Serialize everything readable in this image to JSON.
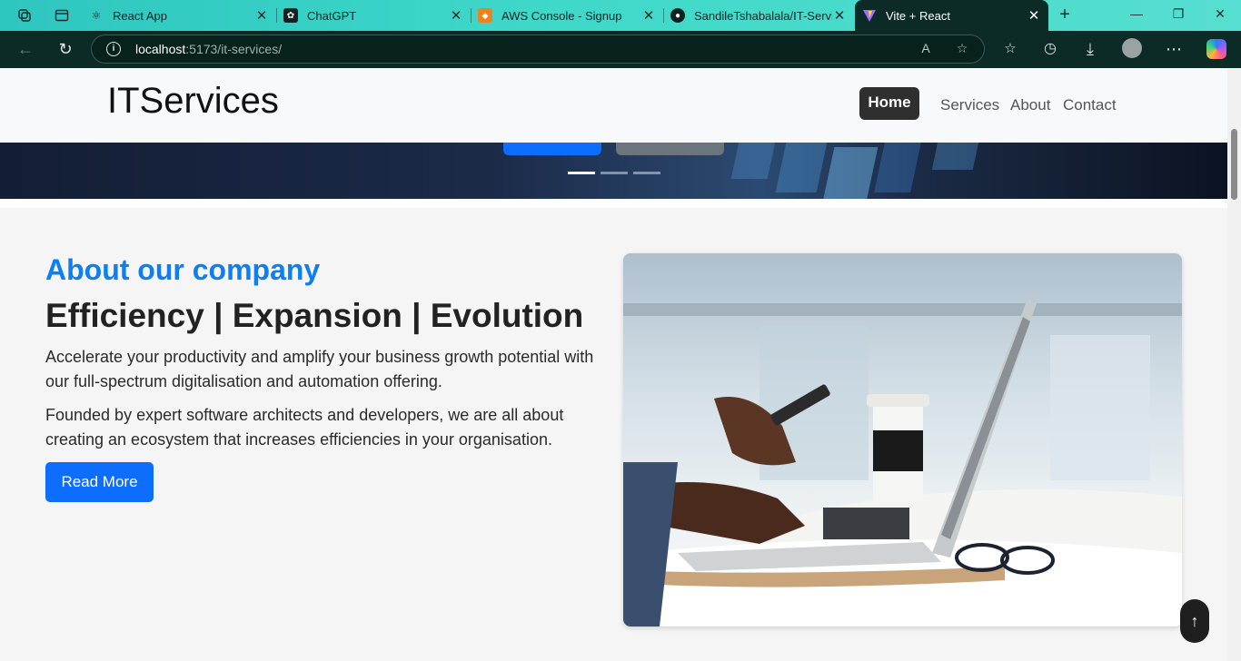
{
  "browser": {
    "tabs": [
      {
        "title": "React App",
        "icon": "react-icon"
      },
      {
        "title": "ChatGPT",
        "icon": "chatgpt-icon"
      },
      {
        "title": "AWS Console - Signup",
        "icon": "aws-icon"
      },
      {
        "title": "SandileTshabalala/IT-Service",
        "icon": "github-icon"
      },
      {
        "title": "Vite + React",
        "icon": "vite-icon",
        "active": true
      }
    ],
    "url_host": "localhost",
    "url_path": ":5173/it-services/",
    "accent": "#3fd8c9"
  },
  "navbar": {
    "brand": "ITServices",
    "links": [
      "Home",
      "Services",
      "About",
      "Contact"
    ],
    "active": "Home"
  },
  "hero": {
    "slides": 3,
    "active_slide": 1
  },
  "about": {
    "title": "About our company",
    "headline": "Efficiency | Expansion | Evolution",
    "paragraph1": "Accelerate your productivity and amplify your business growth potential with our full-spectrum digitalisation and automation offering.",
    "paragraph2": "Founded by expert software architects and developers, we are all about creating an ecosystem that increases efficiencies in your organisation.",
    "button": "Read More",
    "image": "laptop-coffee-phone-photo"
  },
  "scroll_top": "↑",
  "colors": {
    "primary": "#0d6efd",
    "title_blue": "#0d7ff0",
    "home_bg": "#2f2f2f"
  }
}
